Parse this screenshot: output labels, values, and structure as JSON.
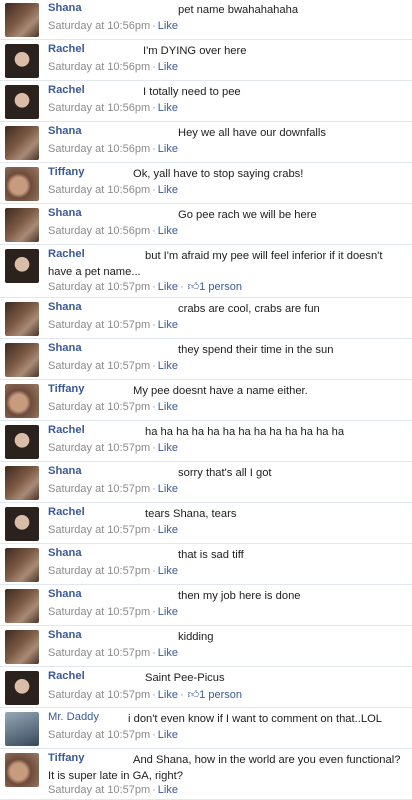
{
  "comments": [
    {
      "name": "Shana",
      "text": "pet name bwahahahaha",
      "time": "Saturday at 10:56pm",
      "like": "Like",
      "likes": ""
    },
    {
      "name": "Rachel",
      "text": "I'm DYING over here",
      "time": "Saturday at 10:56pm",
      "like": "Like",
      "likes": ""
    },
    {
      "name": "Rachel",
      "text": "I totally need to pee",
      "time": "Saturday at 10:56pm",
      "like": "Like",
      "likes": ""
    },
    {
      "name": "Shana",
      "text": "Hey we all have our downfalls",
      "time": "Saturday at 10:56pm",
      "like": "Like",
      "likes": ""
    },
    {
      "name": "Tiffany",
      "text": "Ok, yall have to stop saying crabs!",
      "time": "Saturday at 10:56pm",
      "like": "Like",
      "likes": ""
    },
    {
      "name": "Shana",
      "text": "Go pee rach we will be here",
      "time": "Saturday at 10:56pm",
      "like": "Like",
      "likes": ""
    },
    {
      "name": "Rachel",
      "text": "but I'm afraid my pee will feel inferior if it doesn't have a pet name...",
      "time": "Saturday at 10:57pm",
      "like": "Like",
      "likes": "1 person"
    },
    {
      "name": "Shana",
      "text": "crabs are cool, crabs are fun",
      "time": "Saturday at 10:57pm",
      "like": "Like",
      "likes": ""
    },
    {
      "name": "Shana",
      "text": "they spend their time in the sun",
      "time": "Saturday at 10:57pm",
      "like": "Like",
      "likes": ""
    },
    {
      "name": "Tiffany",
      "text": "My pee doesnt have a name either.",
      "time": "Saturday at 10:57pm",
      "like": "Like",
      "likes": ""
    },
    {
      "name": "Rachel",
      "text": "ha ha ha ha ha ha ha ha ha ha ha ha ha",
      "time": "Saturday at 10:57pm",
      "like": "Like",
      "likes": ""
    },
    {
      "name": "Shana",
      "text": "sorry that's all I got",
      "time": "Saturday at 10:57pm",
      "like": "Like",
      "likes": ""
    },
    {
      "name": "Rachel",
      "text": "tears Shana, tears",
      "time": "Saturday at 10:57pm",
      "like": "Like",
      "likes": ""
    },
    {
      "name": "Shana",
      "text": "that is sad tiff",
      "time": "Saturday at 10:57pm",
      "like": "Like",
      "likes": ""
    },
    {
      "name": "Shana",
      "text": "then my job here is done",
      "time": "Saturday at 10:57pm",
      "like": "Like",
      "likes": ""
    },
    {
      "name": "Shana",
      "text": "kidding",
      "time": "Saturday at 10:57pm",
      "like": "Like",
      "likes": ""
    },
    {
      "name": "Rachel",
      "text": "Saint Pee-Picus",
      "time": "Saturday at 10:57pm",
      "like": "Like",
      "likes": "1 person"
    },
    {
      "name": "Mr. Daddy",
      "text": "i don't even know if I want to comment on that..LOL",
      "time": "Saturday at 10:57pm",
      "like": "Like",
      "likes": ""
    },
    {
      "name": "Tiffany",
      "text": "And Shana, how in the world are you even functional? It is super late in GA, right?",
      "time": "Saturday at 10:57pm",
      "like": "Like",
      "likes": ""
    }
  ],
  "icons": {
    "like_count_icon": "thumbs-up-icon"
  },
  "colors": {
    "name_link": "#3b5998",
    "timestamp": "#8b8b8b",
    "divider": "#e2e6ee"
  }
}
